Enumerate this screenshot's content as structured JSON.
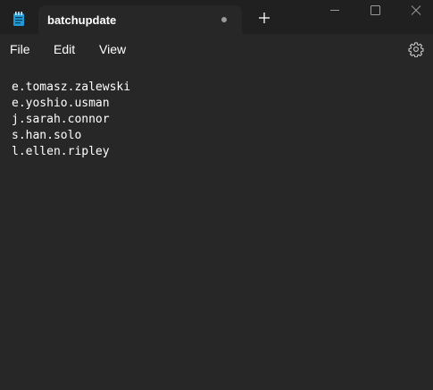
{
  "tab": {
    "title": "batchupdate",
    "unsaved": true
  },
  "menu": {
    "file": "File",
    "edit": "Edit",
    "view": "View"
  },
  "icons": {
    "app": "notepad-icon",
    "unsaved": "unsaved-dot-icon",
    "new_tab": "plus-icon",
    "minimize": "minimize-icon",
    "maximize": "maximize-icon",
    "close": "close-icon",
    "settings": "gear-icon"
  },
  "document": {
    "lines": [
      "e.tomasz.zalewski",
      "e.yoshio.usman",
      "j.sarah.connor",
      "s.han.solo",
      "l.ellen.ripley"
    ]
  },
  "colors": {
    "titlebar": "#202020",
    "background": "#272727",
    "text": "#ffffff",
    "accent": "#1f9ad6"
  }
}
